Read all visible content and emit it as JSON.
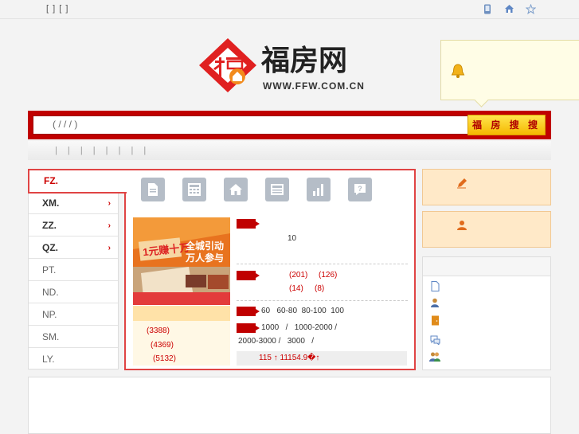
{
  "topbar": {
    "left_text": "[ ] [ ]"
  },
  "logo": {
    "brand": "福房网",
    "url": "WWW.FFW.COM.CN"
  },
  "search": {
    "value": "( / / / )",
    "button": "福 房 搜 搜"
  },
  "hotbar": {
    "text": "| | | | | | | |"
  },
  "cities": [
    {
      "label": "FZ."
    },
    {
      "label": "XM.",
      "arrow": "›"
    },
    {
      "label": "ZZ.",
      "arrow": "›"
    },
    {
      "label": "QZ.",
      "arrow": "›"
    },
    {
      "label": "PT."
    },
    {
      "label": "ND."
    },
    {
      "label": "NP."
    },
    {
      "label": "SM."
    },
    {
      "label": "LY."
    }
  ],
  "promo": {
    "big": "1元赚十万",
    "line1": "全城引动",
    "line2": "万人参与"
  },
  "stats": [
    "(3388)",
    "(4369)",
    "(5132)"
  ],
  "info": {
    "row1": "10",
    "row2a": "(201)",
    "row2b": "(126)",
    "row3a": "(14)",
    "row3b": "(8)",
    "row4": "60   60-80  80-100  100",
    "row5": "1000   /   1000-2000 /",
    "row6": "2000-3000 /   3000   /",
    "price": "115 ↑   11154.9�↑"
  },
  "colors": {
    "accent": "#c00000",
    "button": "#f5b800",
    "panel": "#ffe9c8"
  }
}
